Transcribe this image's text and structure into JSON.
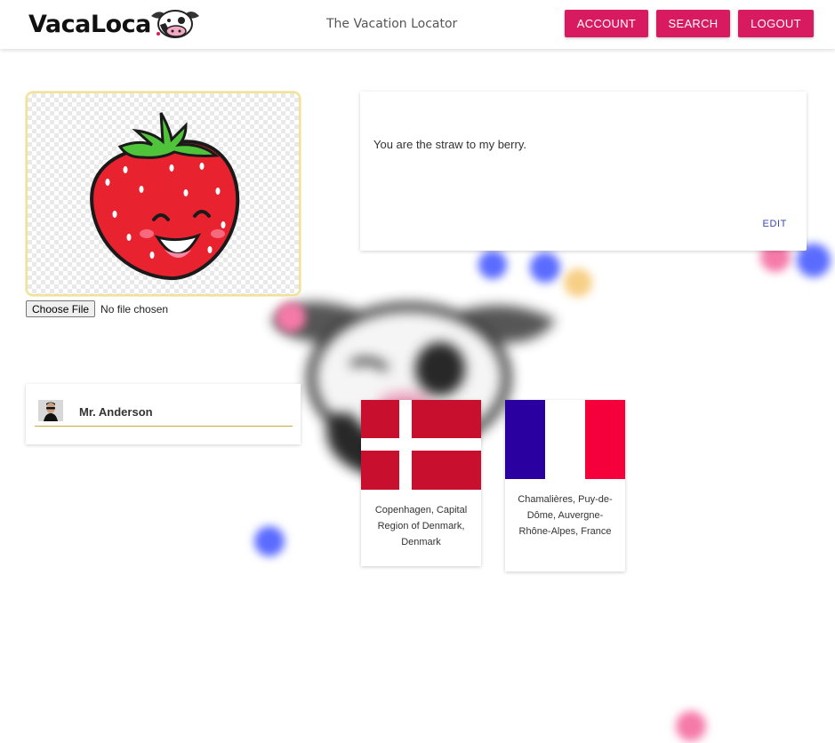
{
  "header": {
    "logo_text": "VacaLoca",
    "tagline": "The Vacation Locator",
    "nav": [
      {
        "label": "ACCOUNT"
      },
      {
        "label": "SEARCH"
      },
      {
        "label": "LOGOUT"
      }
    ]
  },
  "profile": {
    "file_input": {
      "button_label": "Choose File",
      "status": "No file chosen"
    },
    "bio": "You are the straw to my berry.",
    "edit_label": "EDIT"
  },
  "user": {
    "name": "Mr. Anderson"
  },
  "locations": [
    {
      "name": "Copenhagen, Capital Region of Denmark, Denmark",
      "flag": "denmark-flag"
    },
    {
      "name": "Chamalières, Puy-de-Dôme, Auvergne-Rhône-Alpes, France",
      "flag": "france-flag"
    }
  ],
  "colors": {
    "accent": "#d81b60",
    "edit_link": "#3949ab",
    "denmark_red": "#c8102e",
    "france_blue": "#2a00a0",
    "france_red": "#f5003a"
  }
}
